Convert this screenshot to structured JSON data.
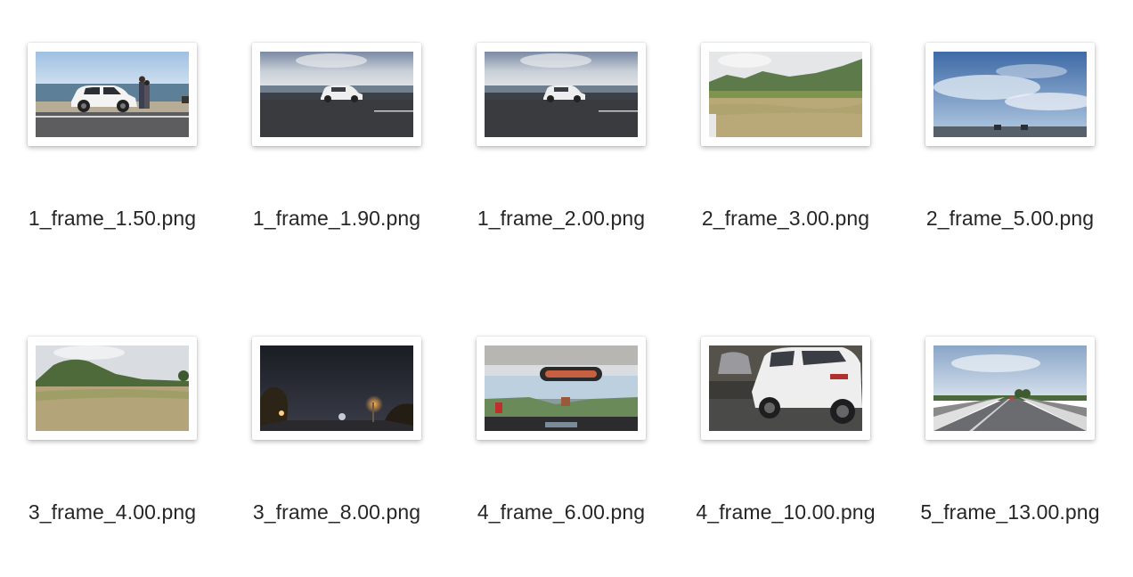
{
  "files": [
    {
      "name": "1_frame_1.50.png",
      "scene": "car-beach"
    },
    {
      "name": "1_frame_1.90.png",
      "scene": "car-sea-road"
    },
    {
      "name": "1_frame_2.00.png",
      "scene": "car-sea-road"
    },
    {
      "name": "2_frame_3.00.png",
      "scene": "hills-field"
    },
    {
      "name": "2_frame_5.00.png",
      "scene": "cloudy-sky-road"
    },
    {
      "name": "3_frame_4.00.png",
      "scene": "hill-grassland"
    },
    {
      "name": "3_frame_8.00.png",
      "scene": "night-road"
    },
    {
      "name": "4_frame_6.00.png",
      "scene": "dashboard-view"
    },
    {
      "name": "4_frame_10.00.png",
      "scene": "white-suv-garage"
    },
    {
      "name": "5_frame_13.00.png",
      "scene": "bridge-highway"
    }
  ]
}
